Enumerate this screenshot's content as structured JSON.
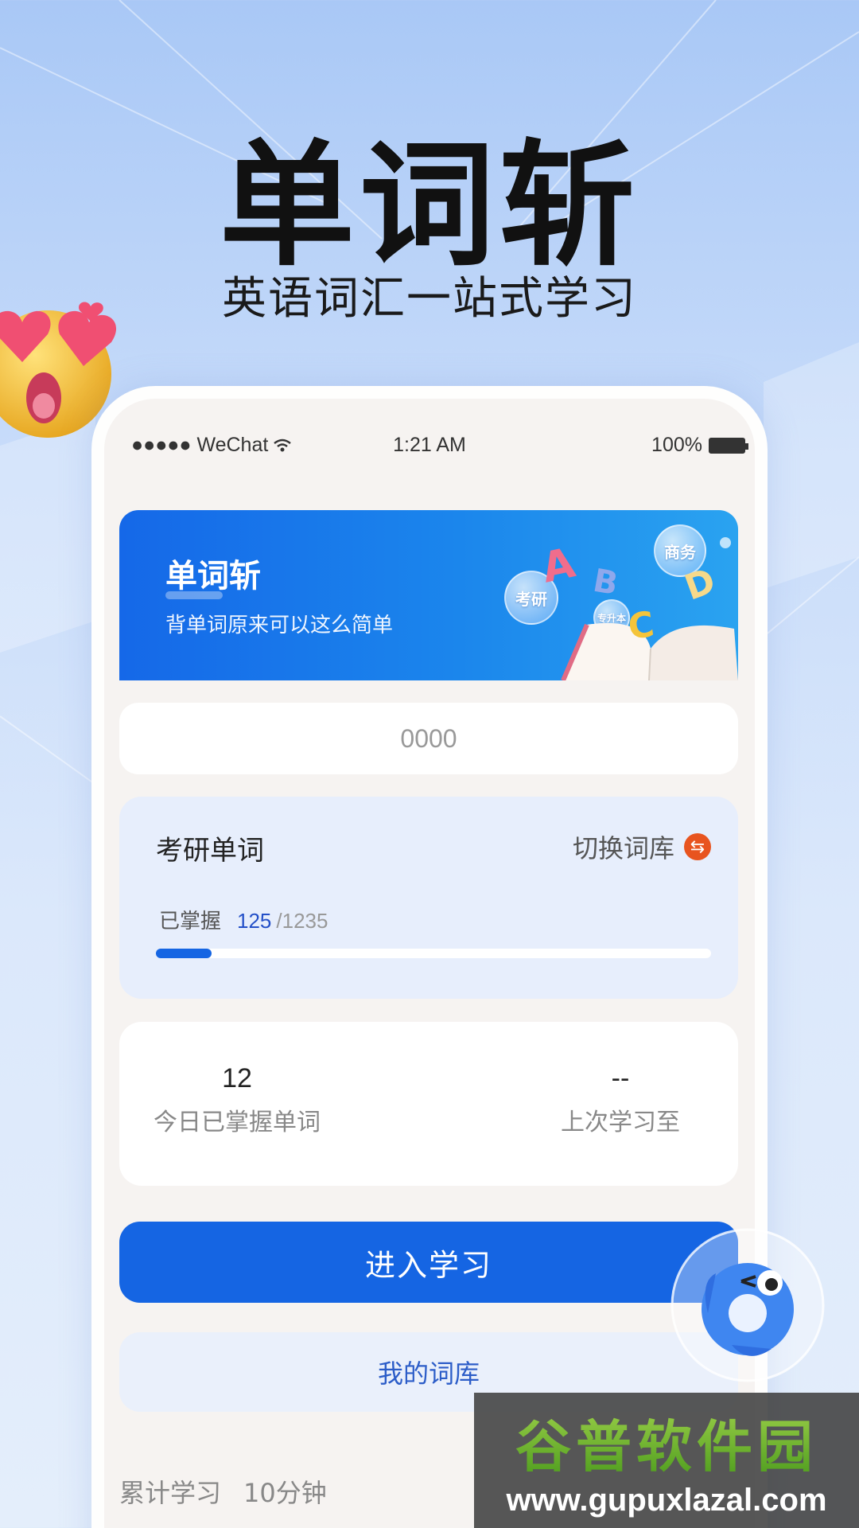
{
  "promo": {
    "title": "单词斩",
    "subtitle": "英语词汇一站式学习"
  },
  "status_bar": {
    "carrier": "●●●●● WeChat",
    "time": "1:21 AM",
    "battery": "100%"
  },
  "banner": {
    "title": "单词斩",
    "subtitle": "背单词原来可以这么简单",
    "bubbles": [
      "商务",
      "考研",
      "专升本"
    ],
    "letters": [
      "A",
      "B",
      "C",
      "D"
    ]
  },
  "search": {
    "value": "0000"
  },
  "library": {
    "name": "考研单词",
    "switch_label": "切换词库",
    "switch_icon": "swap-icon",
    "mastered_label": "已掌握",
    "mastered_count": "125",
    "total_count": "/1235",
    "progress": 0.101,
    "accent_color": "#1565e3"
  },
  "stats": {
    "today": {
      "value": "12",
      "label": "今日已掌握单词"
    },
    "last": {
      "value": "--",
      "label": "上次学习至"
    }
  },
  "actions": {
    "enter_label": "进入学习",
    "my_library_label": "我的词库"
  },
  "summary": {
    "label": "累计学习",
    "value": "10分钟"
  },
  "watermark": {
    "name": "谷普软件园",
    "url": "www.gupuxlazal.com"
  }
}
